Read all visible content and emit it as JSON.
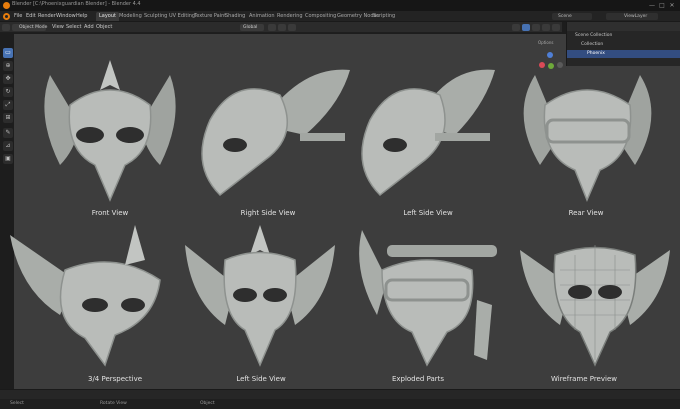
{
  "app": {
    "window_title": "Blender [C:\\Phoenixguardian Blender] - Blender 4.4",
    "window_controls": [
      "—",
      "□",
      "✕"
    ]
  },
  "menubar": {
    "items": [
      "File",
      "Edit",
      "Render",
      "Window",
      "Help"
    ],
    "workspaces": [
      "Layout",
      "Modeling",
      "Sculpting",
      "UV Editing",
      "Texture Paint",
      "Shading",
      "Animation",
      "Rendering",
      "Compositing",
      "Geometry Nodes",
      "Scripting"
    ],
    "active_workspace": "Layout",
    "scene": "Scene",
    "view_layer": "ViewLayer"
  },
  "viewport_header": {
    "mode": "Object Mode",
    "menus": [
      "View",
      "Select",
      "Add",
      "Object"
    ],
    "transform_orientation": "Global",
    "options_label": "Options"
  },
  "outliner": {
    "rows": [
      "Scene Collection",
      "Collection",
      "Phoenix"
    ]
  },
  "colors": {
    "accent_blue": "#4772b3",
    "blender_orange": "#e87d0d",
    "axis_x": "#d94a57",
    "axis_y": "#6ea93a",
    "axis_z": "#4f7fd6",
    "mask_base": "#b9bcb9",
    "mask_shadow": "#8e928f"
  },
  "icons": {
    "tools": [
      "select-box-icon",
      "cursor-icon",
      "move-icon",
      "rotate-icon",
      "scale-icon",
      "transform-icon",
      "annotate-icon",
      "measure-icon",
      "add-cube-icon"
    ]
  },
  "views": [
    {
      "label": "Front View",
      "shape": "front"
    },
    {
      "label": "Right Side View",
      "shape": "side_right"
    },
    {
      "label": "Left Side View",
      "shape": "side_left"
    },
    {
      "label": "Rear View",
      "shape": "rear"
    },
    {
      "label": "3/4 Perspective",
      "shape": "perspective"
    },
    {
      "label": "Left Side View",
      "shape": "side_left_small"
    },
    {
      "label": "Exploded Parts",
      "shape": "exploded"
    },
    {
      "label": "Wireframe Preview",
      "shape": "wireframe"
    }
  ],
  "statusbar": {
    "left": "Select",
    "middle": "Rotate View",
    "right": "Object"
  }
}
